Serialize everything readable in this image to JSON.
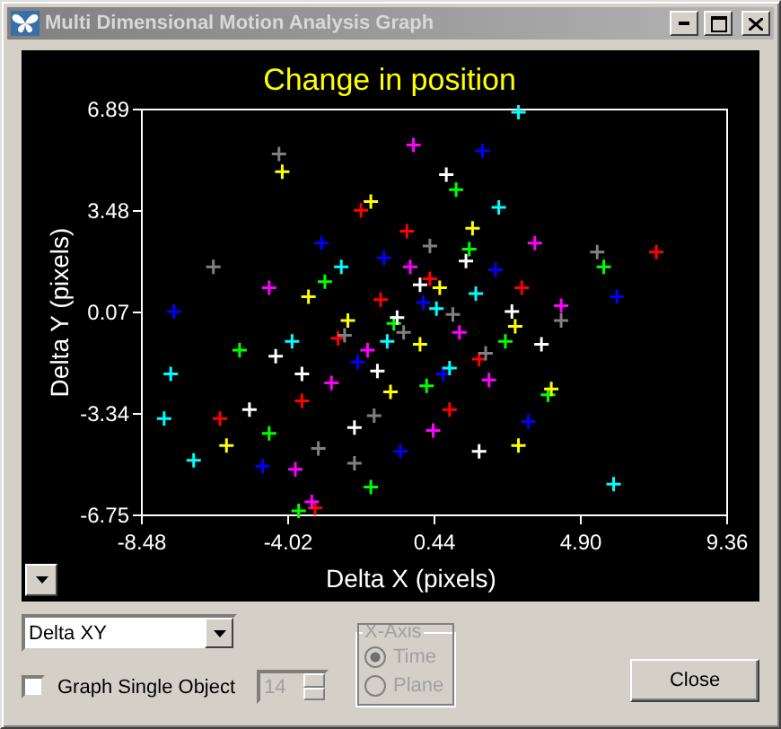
{
  "window": {
    "title": "Multi Dimensional Motion Analysis Graph"
  },
  "graph": {
    "chart_data": {
      "type": "scatter",
      "title": "Change in position",
      "xlabel": "Delta X (pixels)",
      "ylabel": "Delta Y (pixels)",
      "xlim": [
        -8.48,
        9.36
      ],
      "ylim": [
        -6.75,
        6.89
      ],
      "xticks": [
        {
          "value": -8.48,
          "label": "-8.48"
        },
        {
          "value": -4.02,
          "label": "-4.02"
        },
        {
          "value": 0.44,
          "label": "0.44"
        },
        {
          "value": 4.9,
          "label": "4.90"
        },
        {
          "value": 9.36,
          "label": "9.36"
        }
      ],
      "yticks": [
        {
          "value": -6.75,
          "label": "-6.75"
        },
        {
          "value": -3.34,
          "label": "-3.34"
        },
        {
          "value": 0.07,
          "label": "0.07"
        },
        {
          "value": 3.48,
          "label": "3.48"
        },
        {
          "value": 6.89,
          "label": "6.89"
        }
      ],
      "series": [
        {
          "color": "#ff0000",
          "x": [
            -1.2,
            0.3,
            -2.5,
            1.8,
            -0.4,
            3.1,
            -3.6,
            0.9,
            7.2,
            -6.1,
            -3.2,
            -1.8
          ],
          "values": [
            0.5,
            1.2,
            -0.8,
            -1.5,
            2.8,
            0.9,
            -2.9,
            -3.2,
            2.1,
            -3.5,
            -6.5,
            3.5
          ]
        },
        {
          "color": "#00ff00",
          "x": [
            -0.8,
            1.5,
            -2.9,
            0.2,
            5.6,
            -4.6,
            2.6,
            -1.5,
            3.9,
            -5.5,
            -3.7,
            1.1
          ],
          "values": [
            -0.3,
            2.2,
            1.1,
            -2.4,
            1.6,
            -4.0,
            -0.9,
            -5.8,
            -2.7,
            -1.2,
            -6.6,
            4.2
          ]
        },
        {
          "color": "#0000ff",
          "x": [
            0.1,
            -1.9,
            2.3,
            -7.5,
            -0.6,
            1.9,
            6.0,
            -3.0,
            0.7,
            -4.8,
            3.3,
            -1.1
          ],
          "values": [
            0.4,
            -1.6,
            1.5,
            0.1,
            -4.6,
            5.5,
            0.6,
            2.4,
            -2.0,
            -5.1,
            -3.6,
            1.9
          ]
        },
        {
          "color": "#ffff00",
          "x": [
            -1.5,
            0.6,
            -4.2,
            2.9,
            -0.9,
            4.0,
            -5.9,
            1.6,
            -2.2,
            3.0,
            -3.4,
            0.0
          ],
          "values": [
            3.8,
            0.9,
            4.8,
            -0.4,
            -2.6,
            -2.5,
            -4.4,
            2.9,
            -0.2,
            -4.4,
            0.6,
            -1.0
          ]
        },
        {
          "color": "#ff00ff",
          "x": [
            -0.3,
            1.2,
            -2.7,
            -0.2,
            3.5,
            -3.8,
            0.4,
            -4.6,
            2.1,
            -3.3,
            4.3,
            -1.6
          ],
          "values": [
            1.6,
            -0.6,
            -2.3,
            5.7,
            2.4,
            -5.2,
            -3.9,
            0.9,
            -2.2,
            -6.3,
            0.3,
            -1.2
          ]
        },
        {
          "color": "#00ffff",
          "x": [
            0.5,
            -1.0,
            1.7,
            -7.8,
            3.0,
            -6.9,
            -2.4,
            0.9,
            -3.9,
            5.9,
            -7.6,
            2.4
          ],
          "values": [
            0.2,
            -0.9,
            0.7,
            -3.5,
            6.8,
            -4.9,
            1.6,
            -1.8,
            -0.9,
            -5.7,
            -2.0,
            3.6
          ]
        },
        {
          "color": "#ffffff",
          "x": [
            0.0,
            -0.7,
            1.4,
            -2.0,
            2.8,
            -3.6,
            -5.2,
            0.8,
            3.7,
            -1.3,
            1.8,
            -4.4
          ],
          "values": [
            1.0,
            -0.1,
            1.8,
            -3.8,
            0.1,
            -2.0,
            -3.2,
            4.7,
            -1.0,
            -1.9,
            -4.6,
            -1.4
          ]
        },
        {
          "color": "#808080",
          "x": [
            -0.5,
            1.0,
            -2.3,
            -4.3,
            4.3,
            0.3,
            -3.1,
            -1.4,
            2.0,
            -6.3,
            5.4,
            -2.0
          ],
          "values": [
            -0.6,
            0.0,
            -0.7,
            5.4,
            -0.2,
            2.3,
            -4.5,
            -3.4,
            -1.3,
            1.6,
            2.1,
            -5.0
          ]
        }
      ]
    }
  },
  "graph_type": {
    "value": "Delta XY"
  },
  "single_object": {
    "label": "Graph Single Object",
    "checked": false
  },
  "object_number": {
    "value": "14",
    "disabled": true
  },
  "x_axis": {
    "title": "X-Axis",
    "disabled": true,
    "options": [
      {
        "label": "Time",
        "selected": true
      },
      {
        "label": "Plane",
        "selected": false
      }
    ]
  },
  "close_button": {
    "label": "Close"
  }
}
